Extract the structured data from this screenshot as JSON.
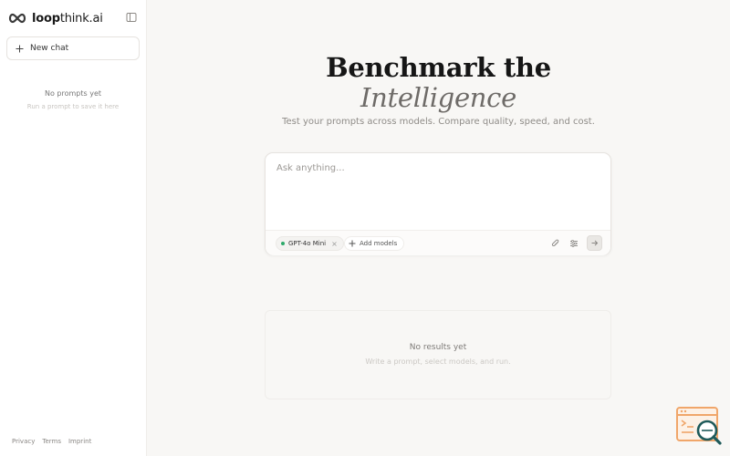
{
  "brand": {
    "name_bold": "loop",
    "name_light": "think.ai"
  },
  "sidebar": {
    "new_chat_label": "New chat",
    "empty_title": "No prompts yet",
    "empty_hint": "Run a prompt to save it here",
    "footer_links": [
      "Privacy",
      "Terms",
      "Imprint"
    ]
  },
  "hero": {
    "title": "Benchmark the",
    "subtitle": "Intelligence",
    "description": "Test your prompts across models. Compare quality, speed, and cost."
  },
  "composer": {
    "placeholder": "Ask anything...",
    "value": "",
    "selected_model": "GPT-4o Mini",
    "remove_glyph": "×",
    "add_models_label": "Add models"
  },
  "results": {
    "empty_title": "No results yet",
    "empty_hint": "Write a prompt, select models, and run."
  },
  "colors": {
    "accent_green": "#2eaa6b",
    "background": "#f8f7f5",
    "badge_orange": "#f0a66a",
    "badge_teal": "#1e5a5a"
  },
  "icons": [
    "infinity-logo-icon",
    "sidebar-toggle-icon",
    "plus-icon",
    "paperclip-icon",
    "sliders-icon",
    "arrow-right-icon",
    "search-window-icon"
  ]
}
